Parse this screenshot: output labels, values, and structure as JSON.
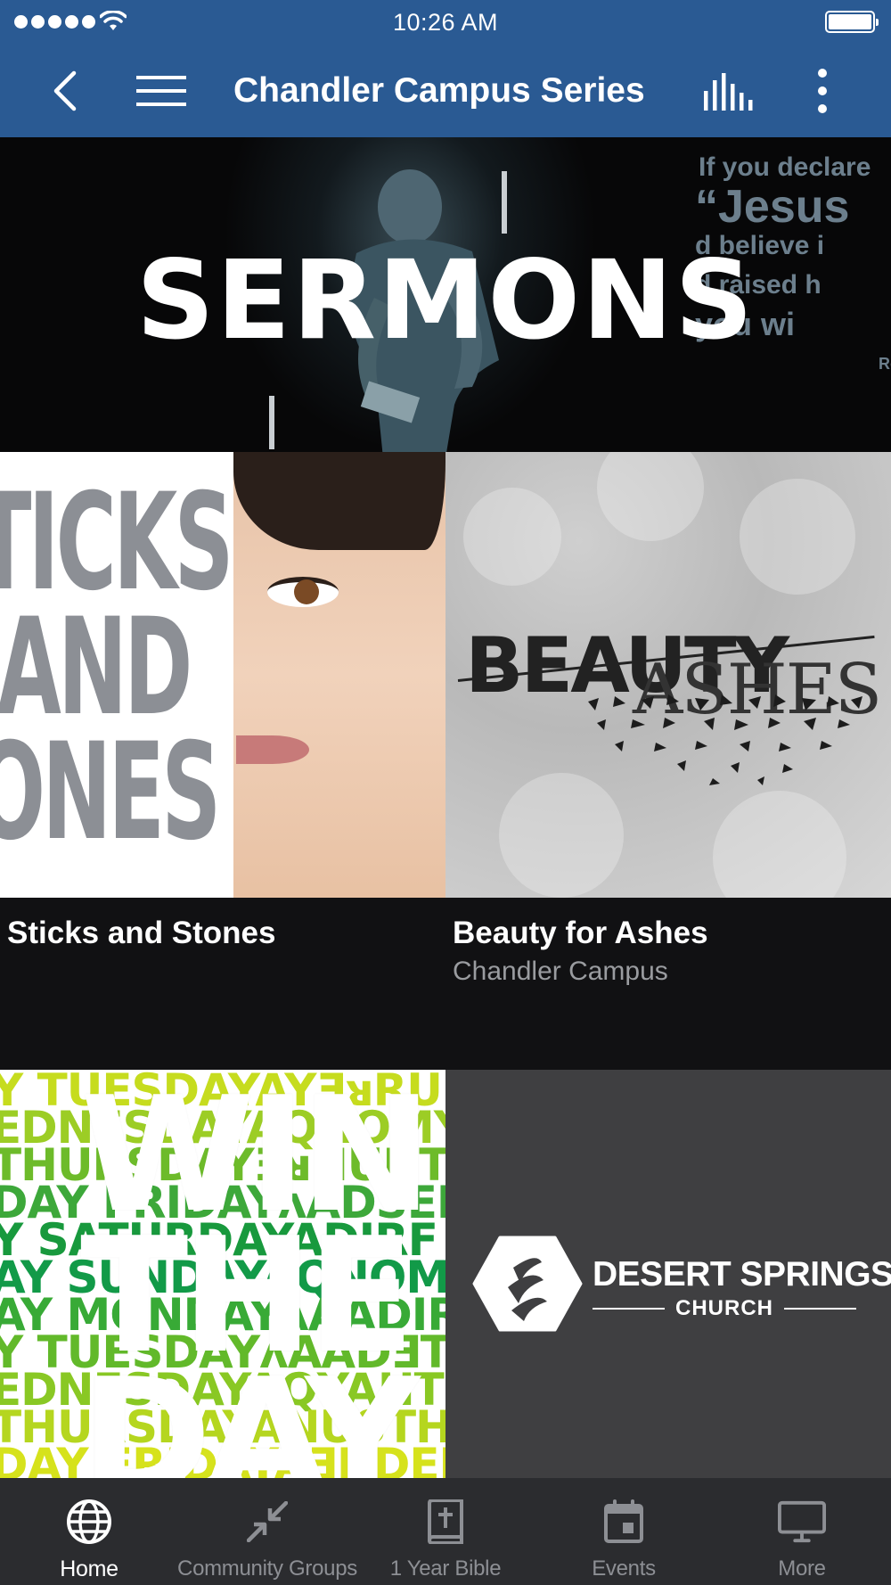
{
  "status_bar": {
    "time": "10:26 AM"
  },
  "header": {
    "title": "Chandler Campus Series"
  },
  "hero": {
    "title": "SERMONS",
    "quote_lines": [
      "If you declare",
      "“Jesus",
      "d believe i",
      "d raised h",
      "you wi",
      "Ro"
    ]
  },
  "series": [
    {
      "title": "Sticks and Stones",
      "subtitle": "",
      "art_words": [
        "TICKS",
        "AND",
        "ONES"
      ]
    },
    {
      "title": "Beauty for Ashes",
      "subtitle": "Chandler Campus",
      "art_words": [
        "BEAUTY",
        "ASHES"
      ]
    },
    {
      "art_words": [
        "WIN",
        "THE",
        "DAY"
      ],
      "art_rows": [
        "Y TUESDAYAYƎᴚRUHTAS",
        "EDNESDAYAQNOMYA",
        "THURSDAYƎᴚNUHTAY",
        "DAY FRIDAYʌADSENDE",
        "Y SATURDAYADIRF T",
        "AY SUNDAYAQNOM YA",
        "AY MONDAYʌAADIRFAY",
        "Y TUESDAYʌAADƎTAS",
        "EDNESDAYAQYAHTUYA",
        "THURSDAYANUSTHTUH",
        "DAY FRIDAYAƎNDEDNE"
      ]
    },
    {
      "logo_name": "DESERT SPRINGS",
      "logo_sub": "CHURCH"
    }
  ],
  "tabs": [
    {
      "label": "Home",
      "icon": "globe-icon",
      "active": true
    },
    {
      "label": "Community Groups",
      "icon": "arrows-in-icon",
      "active": false
    },
    {
      "label": "1 Year Bible",
      "icon": "bible-icon",
      "active": false
    },
    {
      "label": "Events",
      "icon": "calendar-icon",
      "active": false
    },
    {
      "label": "More",
      "icon": "monitor-icon",
      "active": false
    }
  ],
  "colors": {
    "header_bg": "#2a5a93",
    "tab_bar_bg": "#2b2c2f",
    "page_bg": "#111113",
    "tab_active": "#ffffff",
    "tab_inactive": "#8d8f94"
  }
}
